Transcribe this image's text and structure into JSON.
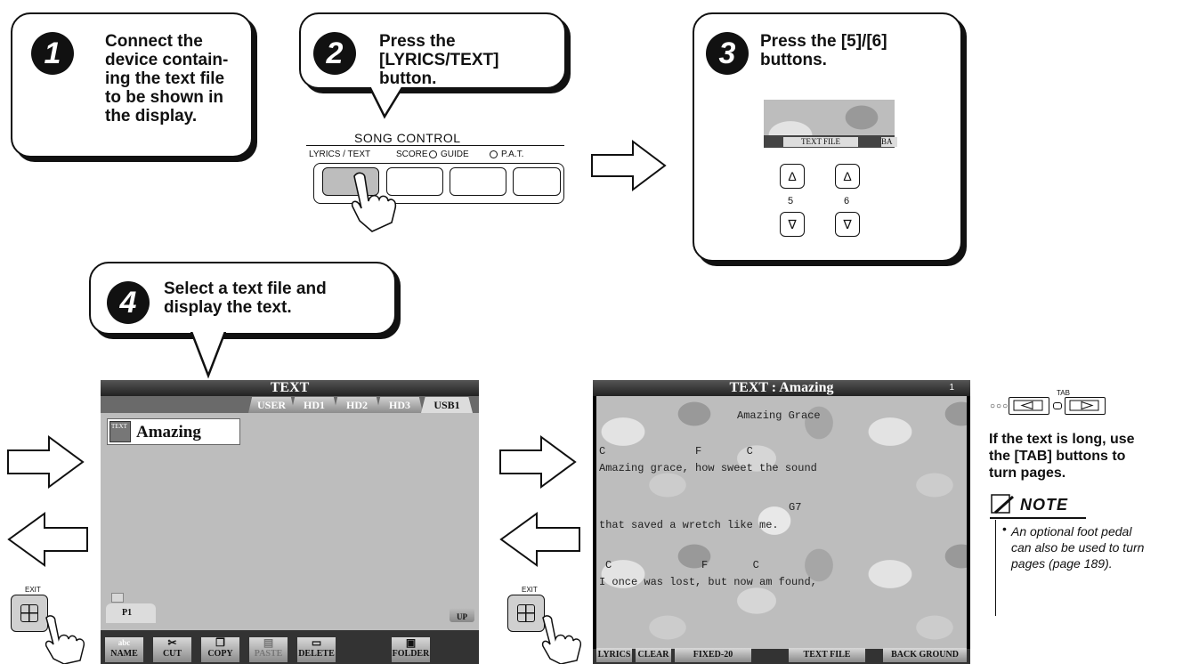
{
  "steps": [
    {
      "num": "1",
      "text": "Connect the\ndevice contain-\ning the text file\nto be shown in\nthe display."
    },
    {
      "num": "2",
      "text": "Press the [LYRICS/TEXT]\nbutton."
    },
    {
      "num": "3",
      "text": "Press the [5]/[6]\nbuttons."
    },
    {
      "num": "4",
      "text": "Select a text file and\ndisplay the text."
    }
  ],
  "song_control": {
    "title": "SONG  CONTROL",
    "labels": [
      "LYRICS / TEXT",
      "SCORE",
      "GUIDE",
      "P.A.T."
    ]
  },
  "panel3": {
    "menu_label": "TEXT FILE",
    "cut_label": "BA",
    "btn5": "5",
    "btn6": "6"
  },
  "screen_left": {
    "title": "TEXT",
    "tabs": [
      "USER",
      "HD1",
      "HD2",
      "HD3",
      "USB1"
    ],
    "file_icon_label": "TEXT",
    "file_name": "Amazing",
    "folder_label": "P1",
    "up_label": "UP",
    "buttons": [
      "NAME",
      "CUT",
      "COPY",
      "PASTE",
      "DELETE",
      "FOLDER"
    ],
    "name_small": "abc"
  },
  "screen_right": {
    "title": "TEXT : Amazing",
    "page": "1",
    "lines": [
      "Amazing Grace",
      "C              F       C",
      "Amazing grace, how sweet the sound",
      "G7",
      "that saved a wretch like me.",
      "C              F       C",
      "I once was lost, but now am found,"
    ],
    "buttons": [
      "LYRICS",
      "CLEAR",
      "FIXED-20",
      "TEXT FILE",
      "BACK GROUND"
    ]
  },
  "exit_label": "EXIT",
  "tab_label": "TAB",
  "tab_help": "If the text is long, use\nthe [TAB] buttons to\nturn pages.",
  "note": {
    "title": "NOTE",
    "text": "An optional foot pedal\ncan also be used to turn\npages (page 189)."
  }
}
